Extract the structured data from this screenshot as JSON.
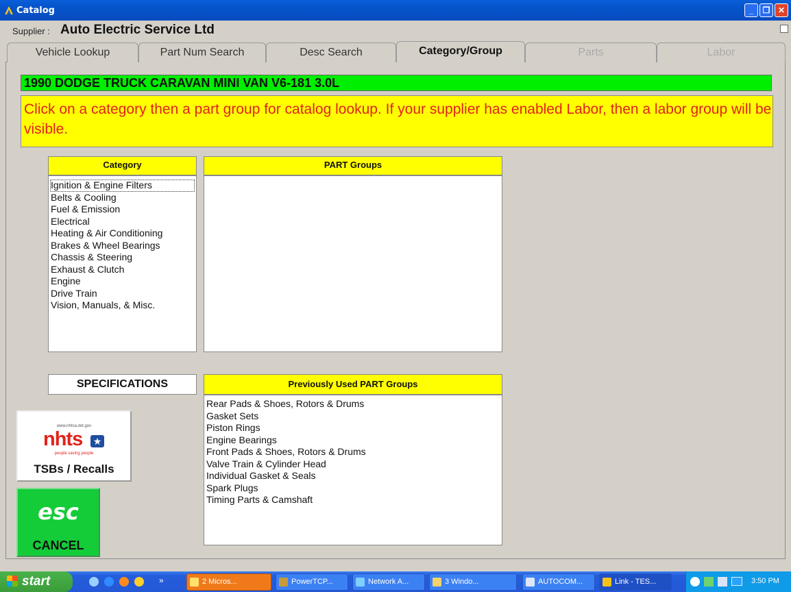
{
  "window": {
    "title": "Catalog",
    "minimize": "_",
    "restore": "❐",
    "close": "✕"
  },
  "supplier": {
    "label": "Supplier :",
    "name": "Auto Electric Service Ltd"
  },
  "tabs": [
    {
      "label": "Vehicle Lookup"
    },
    {
      "label": "Part Num Search"
    },
    {
      "label": "Desc Search"
    },
    {
      "label": "Category/Group",
      "active": true
    },
    {
      "label": "Parts",
      "disabled": true
    },
    {
      "label": "Labor",
      "disabled": true
    }
  ],
  "vehicle": "1990 DODGE TRUCK CARAVAN MINI VAN V6-181  3.0L",
  "instruction": "Click on a category then a part group for catalog lookup. If your supplier has enabled Labor, then a labor group will be visible.",
  "category": {
    "header": "Category",
    "items": [
      "Ignition & Engine Filters",
      "Belts & Cooling",
      "Fuel & Emission",
      "Electrical",
      "Heating & Air Conditioning",
      "Brakes & Wheel Bearings",
      "Chassis & Steering",
      "Exhaust & Clutch",
      "Engine",
      "Drive Train",
      "Vision, Manuals, & Misc."
    ]
  },
  "part_groups": {
    "header": "PART Groups",
    "items": []
  },
  "specifications_label": "SPECIFICATIONS",
  "previous_groups": {
    "header": "Previously Used PART Groups",
    "items": [
      "Rear Pads & Shoes, Rotors & Drums",
      "Gasket Sets",
      "Piston Rings",
      "Engine Bearings",
      "Front Pads & Shoes, Rotors & Drums",
      "Valve Train & Cylinder Head",
      "Individual Gasket & Seals",
      "Spark Plugs",
      "Timing Parts & Camshaft"
    ]
  },
  "nhtsa": {
    "url": "www.nhtsa.dot.gov",
    "logo": "nhts",
    "tagline": "people saving people",
    "label": "TSBs / Recalls"
  },
  "cancel": {
    "esc": "esc",
    "label": "CANCEL"
  },
  "taskbar": {
    "start": "start",
    "tasks": [
      "2 Micros...",
      "PowerTCP...",
      "Network A...",
      "3 Windo...",
      "AUTOCOM...",
      "Link - TES..."
    ],
    "overflow": "»",
    "clock": "3:50 PM"
  }
}
